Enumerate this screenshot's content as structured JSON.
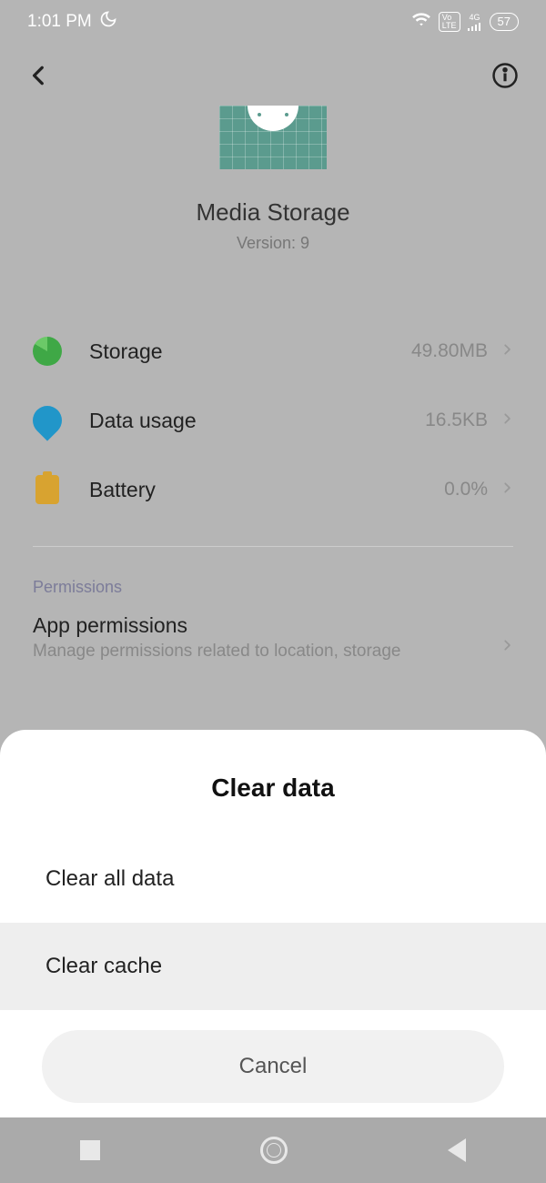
{
  "status": {
    "time": "1:01 PM",
    "lte": "Vo\nLTE",
    "net": "4G",
    "battery": "57"
  },
  "app": {
    "name": "Media Storage",
    "version": "Version: 9"
  },
  "rows": {
    "storage": {
      "label": "Storage",
      "value": "49.80MB"
    },
    "data": {
      "label": "Data usage",
      "value": "16.5KB"
    },
    "battery": {
      "label": "Battery",
      "value": "0.0%"
    }
  },
  "permissions": {
    "section": "Permissions",
    "title": "App permissions",
    "subtitle": "Manage permissions related to location, storage"
  },
  "sheet": {
    "title": "Clear data",
    "all": "Clear all data",
    "cache": "Clear cache",
    "cancel": "Cancel"
  }
}
